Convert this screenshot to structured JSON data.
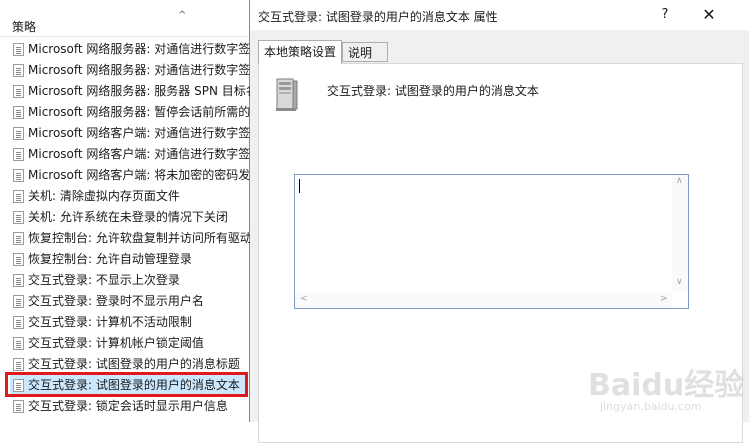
{
  "list": {
    "column_header": "策略",
    "items": [
      {
        "label": "Microsoft 网络服务器: 对通信进行数字签名"
      },
      {
        "label": "Microsoft 网络服务器: 对通信进行数字签名"
      },
      {
        "label": "Microsoft 网络服务器: 服务器 SPN 目标名称"
      },
      {
        "label": "Microsoft 网络服务器: 暂停会话前所需的空闲"
      },
      {
        "label": "Microsoft 网络客户端: 对通信进行数字签名"
      },
      {
        "label": "Microsoft 网络客户端: 对通信进行数字签名"
      },
      {
        "label": "Microsoft 网络客户端: 将未加密的密码发送"
      },
      {
        "label": "关机: 清除虚拟内存页面文件"
      },
      {
        "label": "关机: 允许系统在未登录的情况下关闭"
      },
      {
        "label": "恢复控制台: 允许软盘复制并访问所有驱动器"
      },
      {
        "label": "恢复控制台: 允许自动管理登录"
      },
      {
        "label": "交互式登录: 不显示上次登录"
      },
      {
        "label": "交互式登录: 登录时不显示用户名"
      },
      {
        "label": "交互式登录: 计算机不活动限制"
      },
      {
        "label": "交互式登录: 计算机帐户锁定阈值"
      },
      {
        "label": "交互式登录: 试图登录的用户的消息标题"
      },
      {
        "label": "交互式登录: 试图登录的用户的消息文本",
        "selected": true
      },
      {
        "label": "交互式登录: 锁定会话时显示用户信息"
      }
    ]
  },
  "dialog": {
    "title": "交互式登录: 试图登录的用户的消息文本 属性",
    "help_label": "?",
    "close_label": "✕",
    "tabs": [
      {
        "label": "本地策略设置",
        "active": true
      },
      {
        "label": "说明",
        "active": false
      }
    ],
    "heading": "交互式登录: 试图登录的用户的消息文本",
    "message_text_value": "",
    "icon": "server-icon"
  },
  "watermark": {
    "text": "Baidu经验",
    "sub": "jingyan.baidu.com"
  },
  "colors": {
    "selection_outline": "#e0191d",
    "selection_fill": "#cce8ff",
    "dialog_bg": "#f0f0f0"
  }
}
